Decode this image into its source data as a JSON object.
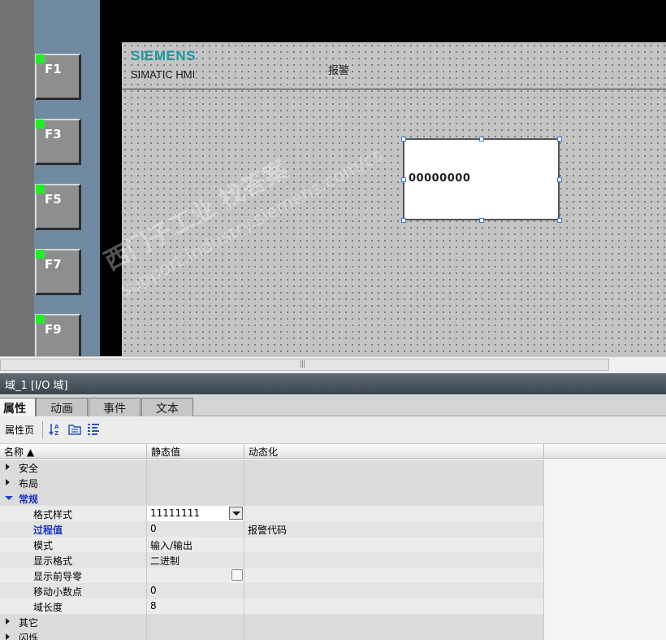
{
  "fkeys": [
    "F1",
    "F3",
    "F5",
    "F7",
    "F9"
  ],
  "screen": {
    "brand": "SIEMENS",
    "product": "SIMATIC HMI",
    "title": "报警"
  },
  "io_field": {
    "value": "00000000"
  },
  "watermark": {
    "text": "西门子工业 找答案",
    "url": "support.industry.siemens.com/cs"
  },
  "scrollbar": {
    "grip": "|||"
  },
  "inspector": {
    "title": "域_1 [I/O 域]",
    "tabs": [
      {
        "label": "属性",
        "active": true
      },
      {
        "label": "动画",
        "active": false
      },
      {
        "label": "事件",
        "active": false
      },
      {
        "label": "文本",
        "active": false
      }
    ],
    "toolbar": {
      "label": "属性页"
    },
    "columns": {
      "name": "名称 ▲",
      "static": "静态值",
      "dynamic": "动态化"
    },
    "rows": [
      {
        "type": "group",
        "name": "安全",
        "open": false
      },
      {
        "type": "group",
        "name": "布局",
        "open": false
      },
      {
        "type": "group",
        "name": "常规",
        "open": true
      },
      {
        "type": "item",
        "name": "格式样式",
        "static": "11111111",
        "dynamic": "",
        "control": "dropdown"
      },
      {
        "type": "item",
        "name": "过程值",
        "static": "0",
        "dynamic": "报警代码",
        "bold": true
      },
      {
        "type": "item",
        "name": "模式",
        "static": "输入/输出",
        "dynamic": ""
      },
      {
        "type": "item",
        "name": "显示格式",
        "static": "二进制",
        "dynamic": ""
      },
      {
        "type": "item",
        "name": "显示前导零",
        "static": "",
        "dynamic": "",
        "control": "checkbox"
      },
      {
        "type": "item",
        "name": "移动小数点",
        "static": "0",
        "dynamic": ""
      },
      {
        "type": "item",
        "name": "域长度",
        "static": "8",
        "dynamic": ""
      },
      {
        "type": "group",
        "name": "其它",
        "open": false
      },
      {
        "type": "group",
        "name": "闪烁",
        "open": false
      }
    ]
  }
}
